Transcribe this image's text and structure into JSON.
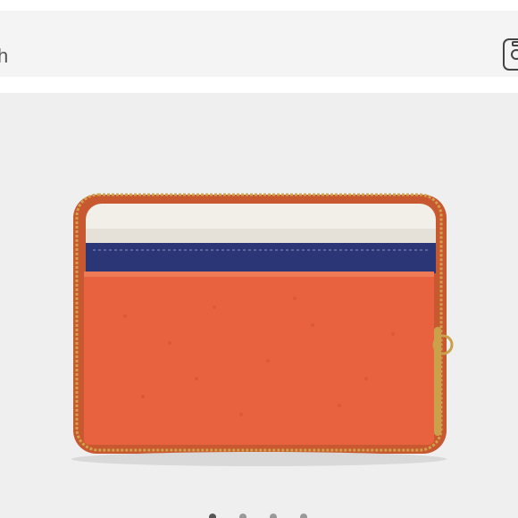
{
  "search": {
    "visible_text": "h",
    "camera_icon": "camera-search-icon"
  },
  "product": {
    "image_icon": "wallet-image",
    "colors": {
      "orange": "#e8623f",
      "navy": "#2b3677",
      "cream": "#f2efe8",
      "zipper": "#c9a24a",
      "background": "#efefef"
    }
  },
  "carousel": {
    "dot_count": 4,
    "active_index": 0
  }
}
